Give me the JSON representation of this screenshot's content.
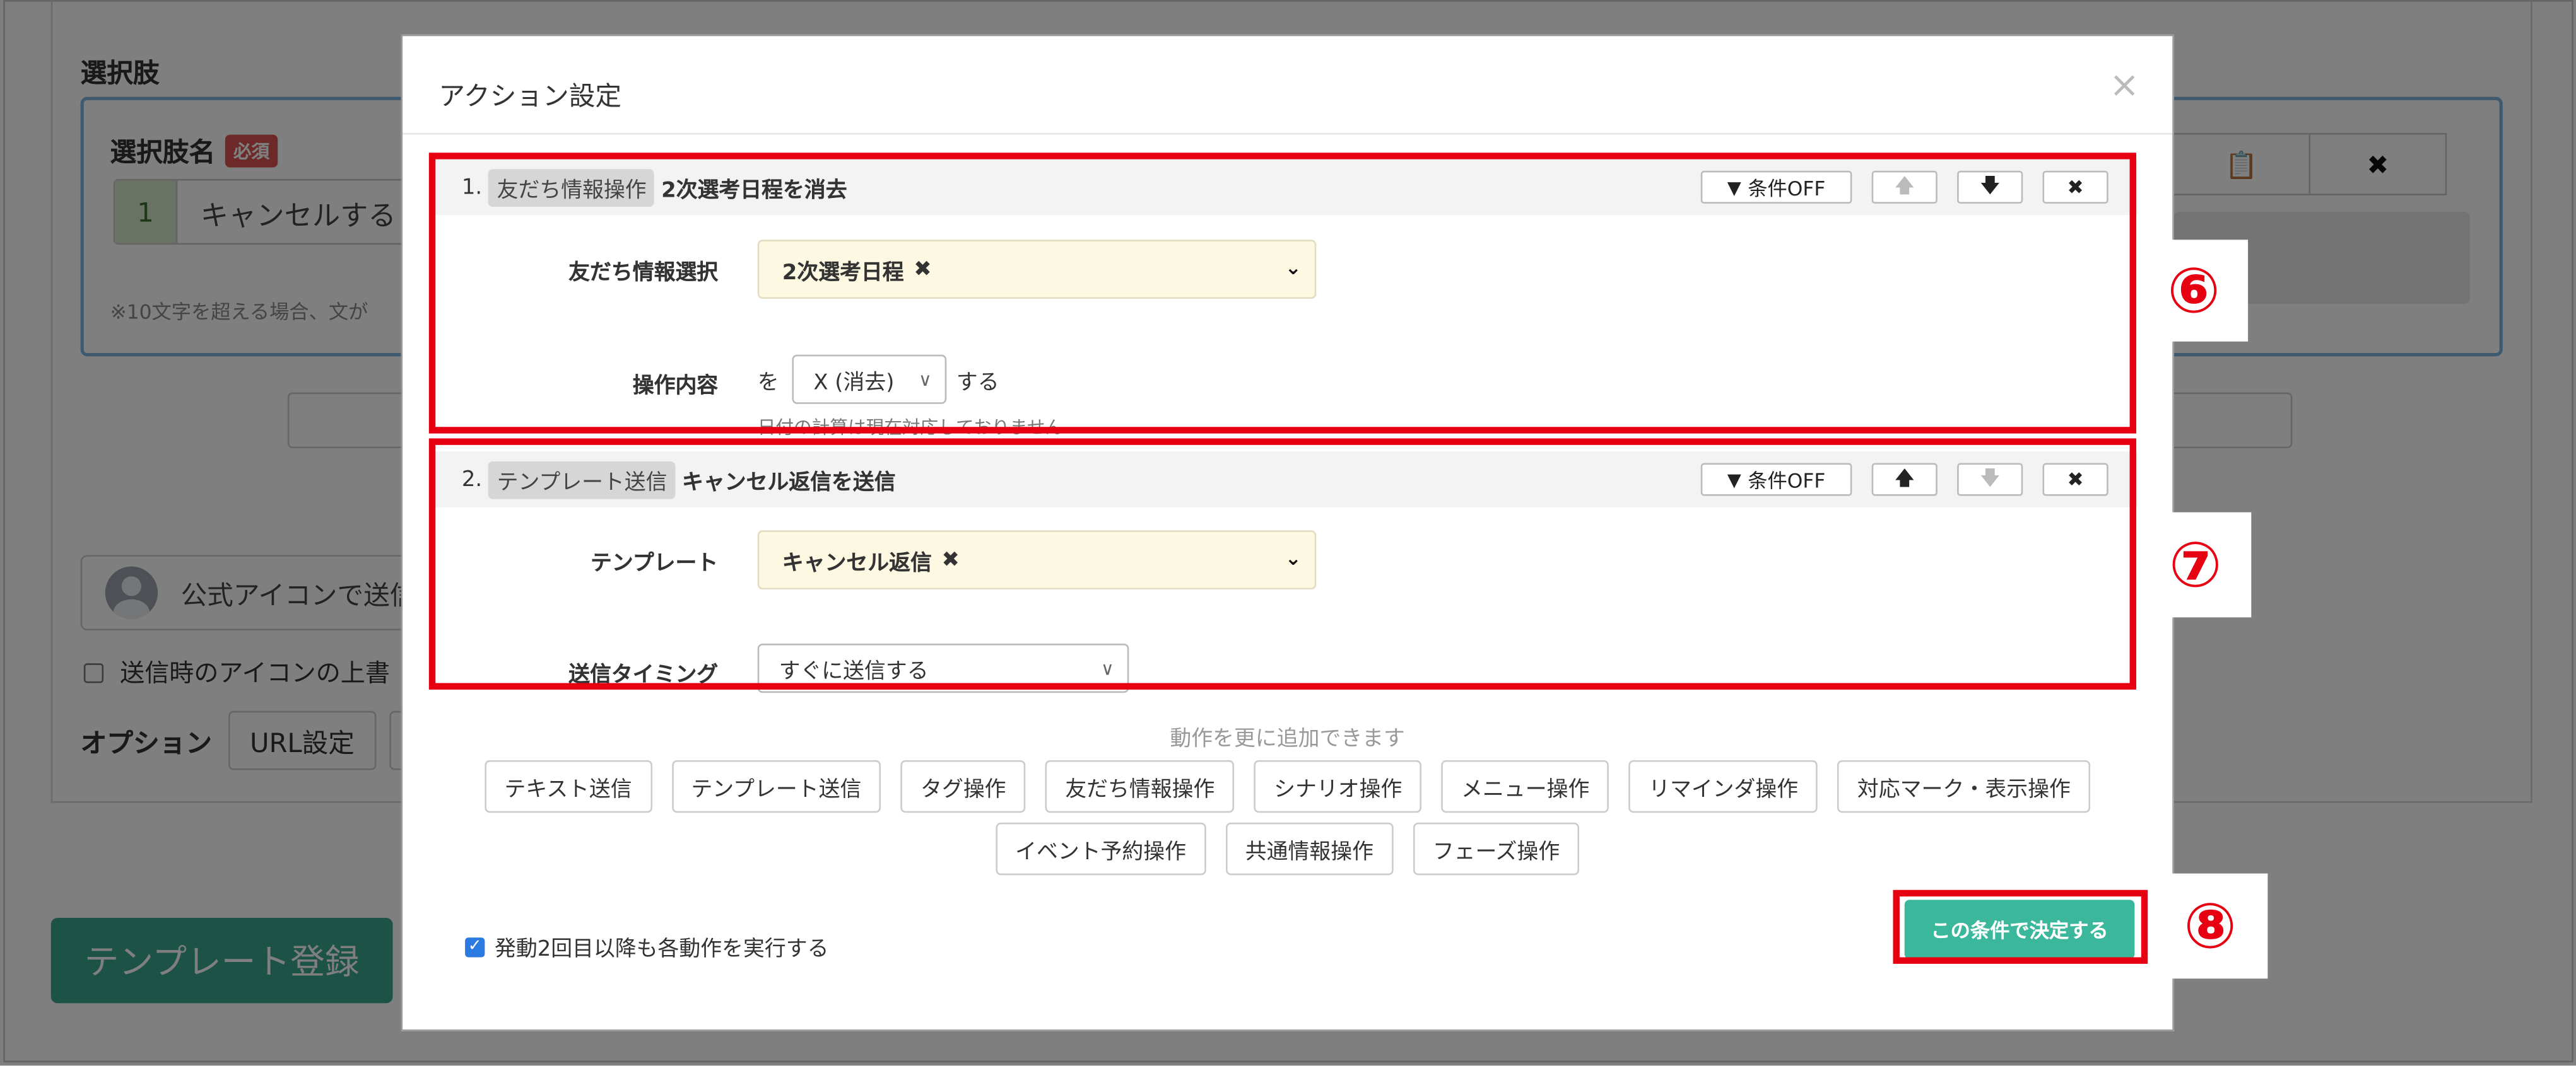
{
  "background": {
    "section_title": "選択肢",
    "choice_label": "選択肢名",
    "required_badge": "必須",
    "choice_number": "1",
    "choice_value": "キャンセルする",
    "hint": "※10文字を超える場合、文が",
    "icon_toolbar": [
      "clipboard-icon",
      "close-icon"
    ],
    "icon_mode_text": "公式アイコンで送信",
    "override_label": "送信時のアイコンの上書",
    "options_label": "オプション",
    "url_button": "URL設定",
    "register_button": "テンプレート登録"
  },
  "modal": {
    "title": "アクション設定",
    "close_symbol": "×",
    "actions": [
      {
        "index": "1.",
        "tag": "友だち情報操作",
        "name": "2次選考日程を消去",
        "controls": {
          "condition": "条件OFF",
          "up": "🡅",
          "down": "🡇",
          "delete": "✖"
        },
        "fields": [
          {
            "label": "友だち情報選択",
            "chip": "2次選考日程"
          },
          {
            "label": "操作内容",
            "prefix": "を",
            "select": "X (消去)",
            "suffix": "する",
            "note": "日付の計算は現在対応しておりません"
          }
        ]
      },
      {
        "index": "2.",
        "tag": "テンプレート送信",
        "name": "キャンセル返信を送信",
        "controls": {
          "condition": "条件OFF",
          "up": "🡅",
          "down": "🡇",
          "delete": "✖"
        },
        "fields": [
          {
            "label": "テンプレート",
            "chip": "キャンセル返信"
          },
          {
            "label": "送信タイミング",
            "select": "すぐに送信する"
          }
        ]
      }
    ],
    "add_prompt": "動作を更に追加できます",
    "add_buttons_row1": [
      "テキスト送信",
      "テンプレート送信",
      "タグ操作",
      "友だち情報操作",
      "シナリオ操作",
      "メニュー操作",
      "リマインダ操作",
      "対応マーク・表示操作"
    ],
    "add_buttons_row2": [
      "イベント予約操作",
      "共通情報操作",
      "フェーズ操作"
    ],
    "repeat_label": "発動2回目以降も各動作を実行する",
    "confirm_button": "この条件で決定する"
  },
  "annotations": {
    "callout_6": "⑥",
    "callout_7": "⑦",
    "callout_8": "⑧",
    "color": "#e60012"
  }
}
